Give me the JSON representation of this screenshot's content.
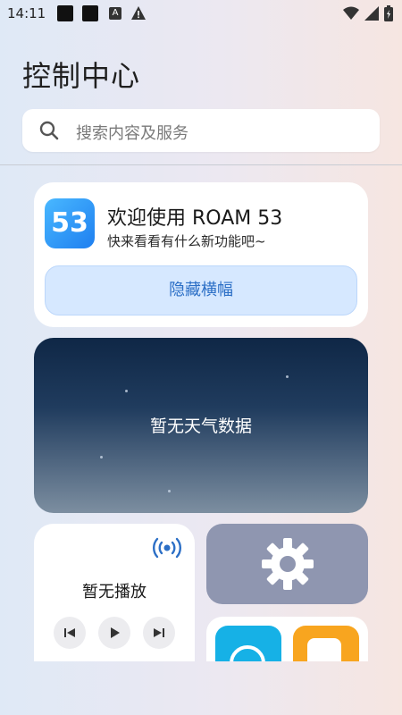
{
  "status": {
    "time": "14:11"
  },
  "page": {
    "title": "控制中心"
  },
  "search": {
    "placeholder": "搜索内容及服务"
  },
  "banner": {
    "logo_text": "53",
    "title": "欢迎使用 ROAM 53",
    "subtitle": "快来看看有什么新功能吧~",
    "hide_label": "隐藏横幅"
  },
  "weather": {
    "empty_text": "暂无天气数据"
  },
  "music": {
    "empty_text": "暂无播放"
  },
  "colors": {
    "accent": "#2c6fc6",
    "banner_button_bg": "#d6e8ff",
    "settings_tile": "#8f96b0",
    "app_blue": "#16b1e6",
    "app_orange": "#f8a51f"
  },
  "icons": [
    "search-icon",
    "radio-waves-icon",
    "previous-icon",
    "play-icon",
    "next-icon",
    "gear-icon",
    "wifi-icon",
    "signal-icon",
    "battery-icon",
    "warning-icon"
  ]
}
